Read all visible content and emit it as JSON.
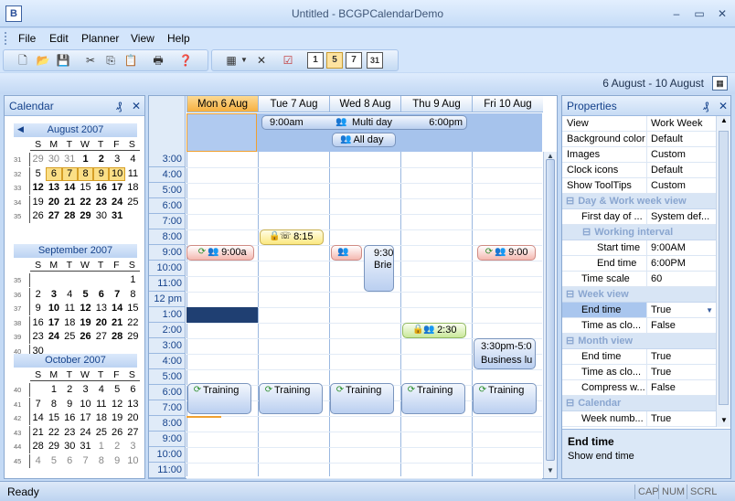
{
  "window": {
    "title": "Untitled - BCGPCalendarDemo",
    "icon_letter": "B",
    "min": "–",
    "max": "▭",
    "close": "✕"
  },
  "menu": [
    "File",
    "Edit",
    "Planner",
    "View",
    "Help"
  ],
  "range": {
    "text": "6 August - 10 August"
  },
  "calendar": {
    "title": "Calendar",
    "pin": "₰",
    "close": "✕",
    "day_letters": [
      "S",
      "M",
      "T",
      "W",
      "T",
      "F",
      "S"
    ],
    "months": [
      {
        "name": "August 2007",
        "weeks": [
          {
            "wn": "31",
            "days": [
              [
                "29",
                "g"
              ],
              [
                "30",
                "g"
              ],
              [
                "31",
                "g"
              ],
              [
                "1",
                "b"
              ],
              [
                "2",
                "b"
              ],
              [
                "3",
                ""
              ],
              [
                "4",
                ""
              ]
            ]
          },
          {
            "wn": "32",
            "days": [
              [
                "5",
                ""
              ],
              [
                "6",
                "s"
              ],
              [
                "7",
                "s"
              ],
              [
                "8",
                "s"
              ],
              [
                "9",
                "s"
              ],
              [
                "10",
                "s"
              ],
              [
                "11",
                ""
              ]
            ]
          },
          {
            "wn": "33",
            "days": [
              [
                "12",
                "b"
              ],
              [
                "13",
                "b"
              ],
              [
                "14",
                "b"
              ],
              [
                "15",
                ""
              ],
              [
                "16",
                "b"
              ],
              [
                "17",
                "b"
              ],
              [
                "18",
                ""
              ]
            ]
          },
          {
            "wn": "34",
            "days": [
              [
                "19",
                ""
              ],
              [
                "20",
                "b"
              ],
              [
                "21",
                "b"
              ],
              [
                "22",
                "b"
              ],
              [
                "23",
                "b"
              ],
              [
                "24",
                "b"
              ],
              [
                "25",
                ""
              ]
            ]
          },
          {
            "wn": "35",
            "days": [
              [
                "26",
                ""
              ],
              [
                "27",
                "b"
              ],
              [
                "28",
                "b"
              ],
              [
                "29",
                "b"
              ],
              [
                "30",
                ""
              ],
              [
                "31",
                "b"
              ],
              [
                "",
                ""
              ]
            ]
          }
        ]
      },
      {
        "name": "September 2007",
        "weeks": [
          {
            "wn": "35",
            "days": [
              [
                "",
                ""
              ],
              [
                "",
                ""
              ],
              [
                "",
                ""
              ],
              [
                "",
                ""
              ],
              [
                "",
                ""
              ],
              [
                "",
                ""
              ],
              [
                "1",
                ""
              ]
            ]
          },
          {
            "wn": "36",
            "days": [
              [
                "2",
                ""
              ],
              [
                "3",
                "b"
              ],
              [
                "4",
                ""
              ],
              [
                "5",
                "b"
              ],
              [
                "6",
                "b"
              ],
              [
                "7",
                "b"
              ],
              [
                "8",
                ""
              ]
            ]
          },
          {
            "wn": "37",
            "days": [
              [
                "9",
                ""
              ],
              [
                "10",
                "b"
              ],
              [
                "11",
                ""
              ],
              [
                "12",
                "b"
              ],
              [
                "13",
                ""
              ],
              [
                "14",
                "b"
              ],
              [
                "15",
                ""
              ]
            ]
          },
          {
            "wn": "38",
            "days": [
              [
                "16",
                ""
              ],
              [
                "17",
                "b"
              ],
              [
                "18",
                ""
              ],
              [
                "19",
                "b"
              ],
              [
                "20",
                "b"
              ],
              [
                "21",
                "b"
              ],
              [
                "22",
                ""
              ]
            ]
          },
          {
            "wn": "39",
            "days": [
              [
                "23",
                ""
              ],
              [
                "24",
                "b"
              ],
              [
                "25",
                ""
              ],
              [
                "26",
                "b"
              ],
              [
                "27",
                ""
              ],
              [
                "28",
                "b"
              ],
              [
                "29",
                ""
              ]
            ]
          },
          {
            "wn": "40",
            "days": [
              [
                "30",
                ""
              ],
              [
                "",
                ""
              ],
              [
                "",
                ""
              ],
              [
                "",
                ""
              ],
              [
                "",
                ""
              ],
              [
                "",
                ""
              ],
              [
                "",
                ""
              ]
            ]
          }
        ]
      },
      {
        "name": "October 2007",
        "weeks": [
          {
            "wn": "40",
            "days": [
              [
                "",
                ""
              ],
              [
                "1",
                ""
              ],
              [
                "2",
                ""
              ],
              [
                "3",
                ""
              ],
              [
                "4",
                ""
              ],
              [
                "5",
                ""
              ],
              [
                "6",
                ""
              ]
            ]
          },
          {
            "wn": "41",
            "days": [
              [
                "7",
                ""
              ],
              [
                "8",
                ""
              ],
              [
                "9",
                ""
              ],
              [
                "10",
                ""
              ],
              [
                "11",
                ""
              ],
              [
                "12",
                ""
              ],
              [
                "13",
                ""
              ]
            ]
          },
          {
            "wn": "42",
            "days": [
              [
                "14",
                ""
              ],
              [
                "15",
                ""
              ],
              [
                "16",
                ""
              ],
              [
                "17",
                ""
              ],
              [
                "18",
                ""
              ],
              [
                "19",
                ""
              ],
              [
                "20",
                ""
              ]
            ]
          },
          {
            "wn": "43",
            "days": [
              [
                "21",
                ""
              ],
              [
                "22",
                ""
              ],
              [
                "23",
                ""
              ],
              [
                "24",
                ""
              ],
              [
                "25",
                ""
              ],
              [
                "26",
                ""
              ],
              [
                "27",
                ""
              ]
            ]
          },
          {
            "wn": "44",
            "days": [
              [
                "28",
                ""
              ],
              [
                "29",
                ""
              ],
              [
                "30",
                ""
              ],
              [
                "31",
                ""
              ],
              [
                "1",
                "g"
              ],
              [
                "2",
                "g"
              ],
              [
                "3",
                "g"
              ]
            ]
          },
          {
            "wn": "45",
            "days": [
              [
                "4",
                "g"
              ],
              [
                "5",
                "g"
              ],
              [
                "6",
                "g"
              ],
              [
                "7",
                "g"
              ],
              [
                "8",
                "g"
              ],
              [
                "9",
                "g"
              ],
              [
                "10",
                "g"
              ]
            ]
          }
        ]
      }
    ]
  },
  "planner": {
    "days": [
      "Mon 6 Aug",
      "Tue 7 Aug",
      "Wed 8 Aug",
      "Thu 9 Aug",
      "Fri 10 Aug"
    ],
    "hours": [
      "3:00",
      "4:00",
      "5:00",
      "6:00",
      "7:00",
      "8:00",
      "9:00",
      "10:00",
      "11:00",
      "12 pm",
      "1:00",
      "2:00",
      "3:00",
      "4:00",
      "5:00",
      "6:00",
      "7:00",
      "8:00",
      "9:00",
      "10:00",
      "11:00"
    ],
    "multi_day": {
      "start": "9:00am",
      "title": "Multi day",
      "end": "6:00pm"
    },
    "all_day": {
      "title": "All day"
    },
    "events": {
      "mon_900": "9:00a",
      "tue_815": "8:15",
      "wed_930": "9:30",
      "wed_brief": "Brie",
      "thu_230": "2:30",
      "fri_900": "9:00",
      "fri_330": "3:30pm-5:0",
      "fri_lunch": "Business lu",
      "training": "Training"
    }
  },
  "properties": {
    "title": "Properties",
    "pin": "₰",
    "close": "✕",
    "rows": [
      {
        "t": "p",
        "n": "View",
        "v": "Work Week"
      },
      {
        "t": "p",
        "n": "Background color",
        "v": "Default"
      },
      {
        "t": "p",
        "n": "Images",
        "v": "Custom"
      },
      {
        "t": "p",
        "n": "Clock icons",
        "v": "Default"
      },
      {
        "t": "p",
        "n": "Show ToolTips",
        "v": "Custom"
      },
      {
        "t": "c",
        "n": "Day & Work week view"
      },
      {
        "t": "p",
        "n": "First day of ...",
        "v": "System def..."
      },
      {
        "t": "c",
        "n": "Working interval"
      },
      {
        "t": "p",
        "n": "Start time",
        "v": "9:00AM"
      },
      {
        "t": "p",
        "n": "End time",
        "v": "6:00PM"
      },
      {
        "t": "p",
        "n": "Time scale",
        "v": "60"
      },
      {
        "t": "c",
        "n": "Week view"
      },
      {
        "t": "p",
        "n": "End time",
        "v": "True"
      },
      {
        "t": "p",
        "n": "Time as clo...",
        "v": "False"
      },
      {
        "t": "c",
        "n": "Month view"
      },
      {
        "t": "p",
        "n": "End time",
        "v": "True"
      },
      {
        "t": "p",
        "n": "Time as clo...",
        "v": "True"
      },
      {
        "t": "p",
        "n": "Compress w...",
        "v": "False"
      },
      {
        "t": "c",
        "n": "Calendar"
      },
      {
        "t": "p",
        "n": "Week numb...",
        "v": "True"
      }
    ],
    "desc_title": "End time",
    "desc_text": "Show end time"
  },
  "status": {
    "text": "Ready",
    "cap": "CAP",
    "num": "NUM",
    "scrl": "SCRL"
  }
}
